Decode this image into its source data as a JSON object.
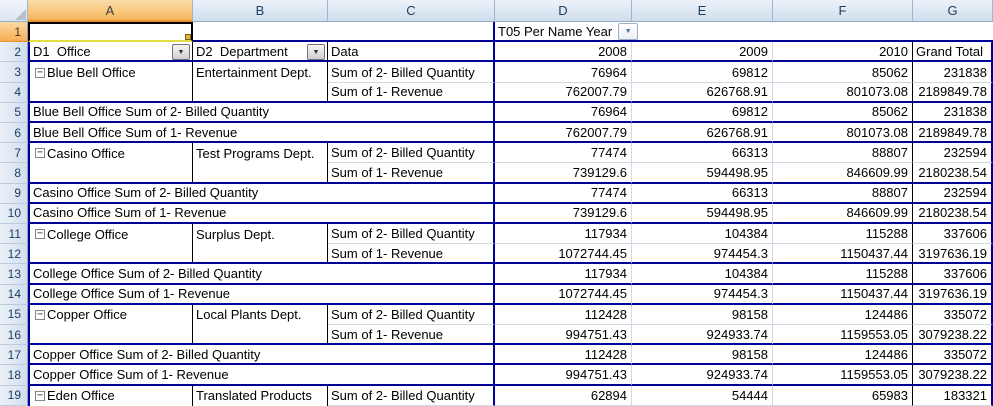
{
  "app": "excel-worksheet",
  "icons": {
    "dropdown": "▼",
    "collapse": "−"
  },
  "colors": {
    "pivot_border": "#000099",
    "grid_line": "#D0D7E5",
    "selected_header_orange": "#F5B45D"
  },
  "sheet": {
    "columns": [
      "A",
      "B",
      "C",
      "D",
      "E",
      "F",
      "G"
    ],
    "active_cell": "A1",
    "rows": [
      {
        "n": "1",
        "type": "page",
        "page_field": "T05 Per Name Year"
      },
      {
        "n": "2",
        "type": "fields",
        "office_field": "D1  Office",
        "dept_field": "D2  Department",
        "data_field": "Data",
        "col_labels": [
          "2008",
          "2009",
          "2010",
          "Grand Total"
        ]
      },
      {
        "n": "3",
        "type": "block",
        "office": "Blue Bell Office",
        "dept": "Entertainment Dept.",
        "data_label": "Sum of 2- Billed Quantity",
        "values": [
          "76964",
          "69812",
          "85062",
          "231838"
        ]
      },
      {
        "n": "4",
        "type": "cont",
        "data_label": "Sum of 1- Revenue",
        "values": [
          "762007.79",
          "626768.91",
          "801073.08",
          "2189849.78"
        ]
      },
      {
        "n": "5",
        "type": "subtotal",
        "label": "Blue Bell Office Sum of 2- Billed Quantity",
        "values": [
          "76964",
          "69812",
          "85062",
          "231838"
        ]
      },
      {
        "n": "6",
        "type": "subtotal",
        "label": "Blue Bell Office Sum of 1- Revenue",
        "values": [
          "762007.79",
          "626768.91",
          "801073.08",
          "2189849.78"
        ]
      },
      {
        "n": "7",
        "type": "block",
        "office": "Casino Office",
        "dept": "Test Programs Dept.",
        "data_label": "Sum of 2- Billed Quantity",
        "values": [
          "77474",
          "66313",
          "88807",
          "232594"
        ]
      },
      {
        "n": "8",
        "type": "cont",
        "data_label": "Sum of 1- Revenue",
        "values": [
          "739129.6",
          "594498.95",
          "846609.99",
          "2180238.54"
        ]
      },
      {
        "n": "9",
        "type": "subtotal",
        "label": "Casino Office Sum of 2- Billed Quantity",
        "values": [
          "77474",
          "66313",
          "88807",
          "232594"
        ]
      },
      {
        "n": "10",
        "type": "subtotal",
        "label": "Casino Office Sum of 1- Revenue",
        "values": [
          "739129.6",
          "594498.95",
          "846609.99",
          "2180238.54"
        ]
      },
      {
        "n": "11",
        "type": "block",
        "office": "College Office",
        "dept": "Surplus Dept.",
        "data_label": "Sum of 2- Billed Quantity",
        "values": [
          "117934",
          "104384",
          "115288",
          "337606"
        ]
      },
      {
        "n": "12",
        "type": "cont",
        "data_label": "Sum of 1- Revenue",
        "values": [
          "1072744.45",
          "974454.3",
          "1150437.44",
          "3197636.19"
        ]
      },
      {
        "n": "13",
        "type": "subtotal",
        "label": "College Office Sum of 2- Billed Quantity",
        "values": [
          "117934",
          "104384",
          "115288",
          "337606"
        ]
      },
      {
        "n": "14",
        "type": "subtotal",
        "label": "College Office Sum of 1- Revenue",
        "values": [
          "1072744.45",
          "974454.3",
          "1150437.44",
          "3197636.19"
        ]
      },
      {
        "n": "15",
        "type": "block",
        "office": "Copper Office",
        "dept": "Local Plants Dept.",
        "data_label": "Sum of 2- Billed Quantity",
        "values": [
          "112428",
          "98158",
          "124486",
          "335072"
        ]
      },
      {
        "n": "16",
        "type": "cont",
        "data_label": "Sum of 1- Revenue",
        "values": [
          "994751.43",
          "924933.74",
          "1159553.05",
          "3079238.22"
        ]
      },
      {
        "n": "17",
        "type": "subtotal",
        "label": "Copper Office Sum of 2- Billed Quantity",
        "values": [
          "112428",
          "98158",
          "124486",
          "335072"
        ]
      },
      {
        "n": "18",
        "type": "subtotal",
        "label": "Copper Office Sum of 1- Revenue",
        "values": [
          "994751.43",
          "924933.74",
          "1159553.05",
          "3079238.22"
        ]
      },
      {
        "n": "19",
        "type": "block",
        "office": "Eden Office",
        "dept": "Translated Products",
        "data_label": "Sum of 2- Billed Quantity",
        "values": [
          "62894",
          "54444",
          "65983",
          "183321"
        ]
      }
    ]
  }
}
